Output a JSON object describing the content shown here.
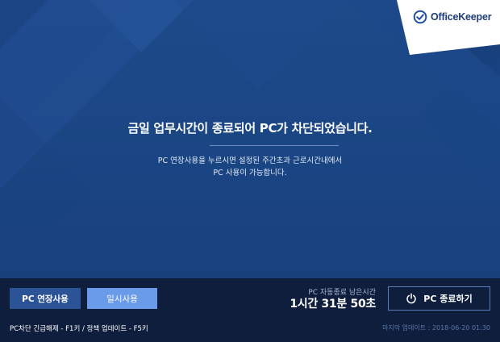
{
  "brand": {
    "logo_text": "OfficeKeeper"
  },
  "message": {
    "headline": "금일 업무시간이 종료되어 PC가 차단되었습니다.",
    "description_line1": "PC 연장사용을 누르시면 설정된 주간초과 근로시간내에서",
    "description_line2": "PC 사용이 가능합니다."
  },
  "actions": {
    "extend_label": "PC 연장사용",
    "temp_label": "일시사용",
    "shutdown_label": "PC 종료하기"
  },
  "countdown": {
    "label": "PC 자동종료 남은시간",
    "remaining": "1시간 31분 50초"
  },
  "footer": {
    "hotkeys": "PC차단 긴급해제 - F1키 / 정책 업데이트 - F5키",
    "last_update": "마지막 업데이트 : 2018-06-20 01:30"
  },
  "colors": {
    "background": "#1b4482",
    "bottom_bar": "#0f1e3d",
    "primary_button": "#2b5396",
    "secondary_button": "#6a9be8",
    "logo_blue": "#1f3d7a"
  },
  "icons": {
    "logo": "checkmark-circle-icon",
    "shutdown": "power-icon"
  }
}
